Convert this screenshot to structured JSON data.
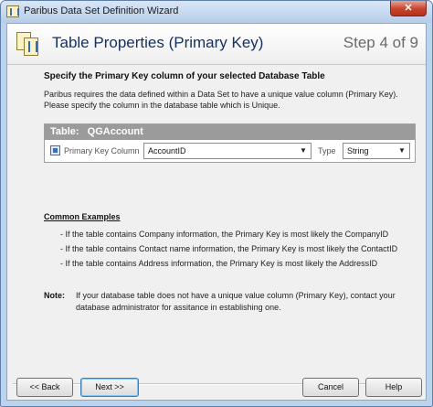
{
  "window": {
    "title": "Paribus Data Set Definition Wizard",
    "close_glyph": "✕"
  },
  "header": {
    "title": "Table Properties (Primary Key)",
    "step": "Step 4 of 9",
    "icon": "wizard-document-icon"
  },
  "content": {
    "heading": "Specify the Primary Key column of your selected Database Table",
    "description_line1": "Paribus requires the data defined within a Data Set to have a unique value column (Primary Key).",
    "description_line2": "Please specify the column in the database table which is Unique."
  },
  "table_panel": {
    "table_prefix": "Table:",
    "table_name": "QGAccount",
    "primary_key_label": "Primary Key Column",
    "primary_key_value": "AccountID",
    "type_label": "Type",
    "type_value": "String"
  },
  "examples": {
    "title": "Common Examples",
    "items": [
      "- If the table contains Company information, the Primary Key is most likely the CompanyID",
      "- If the table contains Contact name information, the Primary Key is most likely the ContactID",
      "- If the table contains Address information, the Primary Key is most likely the AddressID"
    ]
  },
  "note": {
    "label": "Note:",
    "line1": "If your database table does not have a unique value column (Primary Key), contact your",
    "line2": "database administrator for assitance in establishing one."
  },
  "buttons": {
    "back": "<< Back",
    "next": "Next >>",
    "cancel": "Cancel",
    "help": "Help"
  },
  "colors": {
    "title_text": "#14305f",
    "banner": "#9b9b9b",
    "frame": "#bcd3ee"
  }
}
